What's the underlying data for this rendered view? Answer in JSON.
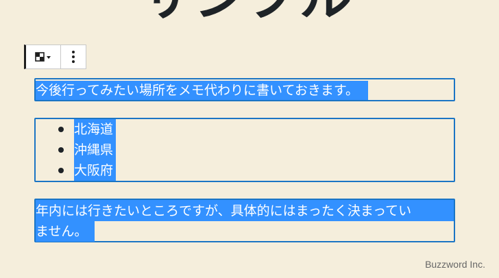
{
  "page": {
    "title": "サンプル"
  },
  "toolbar": {
    "switcher_icon": "block-switcher-icon",
    "more_icon": "more-vertical-icon"
  },
  "blocks": {
    "paragraph1": {
      "text": "今後行ってみたい場所をメモ代わりに書いておきます。"
    },
    "list": {
      "items": [
        "北海道",
        "沖縄県",
        "大阪府"
      ]
    },
    "paragraph2": {
      "line1": "年内には行きたいところですが、具体的にはまったく決まってい",
      "line2": "ません。"
    }
  },
  "footer": {
    "brand": "Buzzword Inc."
  },
  "colors": {
    "background": "#f5eedc",
    "selection": "#3391ff",
    "block_border": "#1b75c4",
    "title": "#1e2327"
  }
}
